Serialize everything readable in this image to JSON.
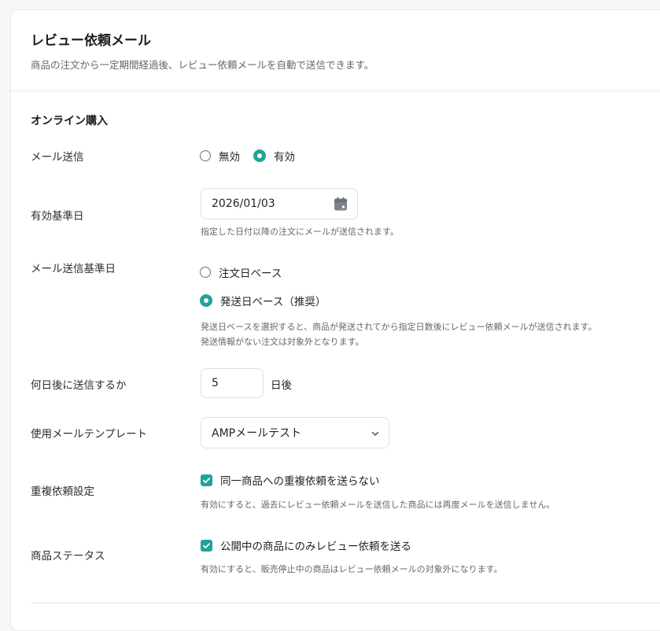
{
  "header": {
    "title": "レビュー依頼メール",
    "subtitle": "商品の注文から一定期間経過後、レビュー依頼メールを自動で送信できます。"
  },
  "section": {
    "title": "オンライン購入"
  },
  "mail_sending": {
    "label": "メール送信",
    "options": [
      "無効",
      "有効"
    ],
    "selected": "有効"
  },
  "effective_date": {
    "label": "有効基準日",
    "value": "2026/01/03",
    "icon": "calendar-icon",
    "help": "指定した日付以降の注文にメールが送信されます。"
  },
  "base_date": {
    "label": "メール送信基準日",
    "options": [
      "注文日ベース",
      "発送日ベース（推奨）"
    ],
    "selected": "発送日ベース（推奨）",
    "help_line1": "発送日ベースを選択すると、商品が発送されてから指定日数後にレビュー依頼メールが送信されます。",
    "help_line2": "発送情報がない注文は対象外となります。"
  },
  "days_after": {
    "label": "何日後に送信するか",
    "value": "5",
    "suffix": "日後"
  },
  "template": {
    "label": "使用メールテンプレート",
    "selected": "AMPメールテスト",
    "icon": "chevron-down-icon"
  },
  "duplicate": {
    "label": "重複依頼設定",
    "checkbox_label": "同一商品への重複依頼を送らない",
    "checked": true,
    "help": "有効にすると、過去にレビュー依頼メールを送信した商品には再度メールを送信しません。"
  },
  "product_status": {
    "label": "商品ステータス",
    "checkbox_label": "公開中の商品にのみレビュー依頼を送る",
    "checked": true,
    "help": "有効にすると、販売停止中の商品はレビュー依頼メールの対象外になります。"
  },
  "colors": {
    "accent": "#1fa39a",
    "background": "#f6f7f7",
    "card": "#ffffff"
  }
}
